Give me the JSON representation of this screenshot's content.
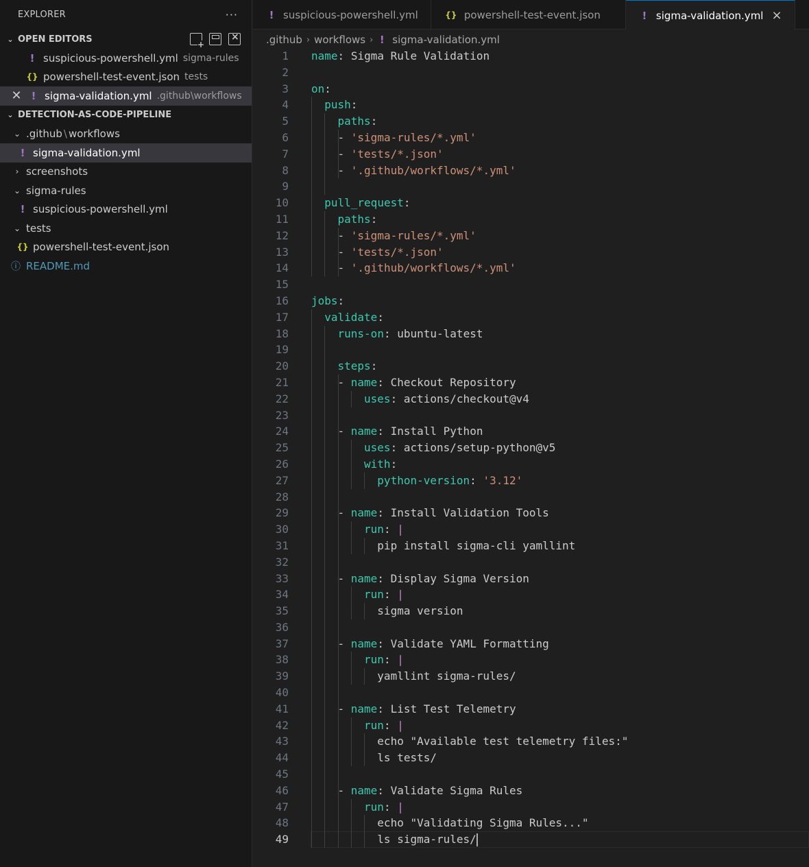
{
  "sidebar": {
    "title": "EXPLORER",
    "more": "···",
    "open_editors": {
      "label": "OPEN EDITORS",
      "items": [
        {
          "name": "suspicious-powershell.yml",
          "desc": "sigma-rules",
          "icon": "yaml-icon"
        },
        {
          "name": "powershell-test-event.json",
          "desc": "tests",
          "icon": "json-icon"
        },
        {
          "name": "sigma-validation.yml",
          "desc": ".github\\workflows",
          "icon": "yaml-icon"
        }
      ]
    },
    "project": {
      "label": "DETECTION-AS-CODE-PIPELINE",
      "tree": {
        "github_folder": ".github",
        "github_sep": "\\",
        "github_sub": "workflows",
        "workflow_file": "sigma-validation.yml",
        "screenshots": "screenshots",
        "sigma_rules": "sigma-rules",
        "sigma_file": "suspicious-powershell.yml",
        "tests": "tests",
        "tests_file": "powershell-test-event.json",
        "readme": "README.md"
      }
    }
  },
  "tabs": [
    {
      "label": "suspicious-powershell.yml"
    },
    {
      "label": "powershell-test-event.json"
    },
    {
      "label": "sigma-validation.yml",
      "close": "×"
    }
  ],
  "breadcrumb": [
    ".github",
    "workflows",
    "sigma-validation.yml"
  ],
  "editor": {
    "lines": [
      {
        "n": "1",
        "k": "name",
        "v": "Sigma Rule Validation"
      },
      {
        "n": "2"
      },
      {
        "n": "3",
        "k": "on"
      },
      {
        "n": "4",
        "k": "push"
      },
      {
        "n": "5",
        "k": "paths"
      },
      {
        "n": "6",
        "dash": "- ",
        "s": "'sigma-rules/*.yml'"
      },
      {
        "n": "7",
        "dash": "- ",
        "s": "'tests/*.json'"
      },
      {
        "n": "8",
        "dash": "- ",
        "s": "'.github/workflows/*.yml'"
      },
      {
        "n": "9"
      },
      {
        "n": "10",
        "k": "pull_request"
      },
      {
        "n": "11",
        "k": "paths"
      },
      {
        "n": "12",
        "dash": "- ",
        "s": "'sigma-rules/*.yml'"
      },
      {
        "n": "13",
        "dash": "- ",
        "s": "'tests/*.json'"
      },
      {
        "n": "14",
        "dash": "- ",
        "s": "'.github/workflows/*.yml'"
      },
      {
        "n": "15"
      },
      {
        "n": "16",
        "k": "jobs"
      },
      {
        "n": "17",
        "k": "validate"
      },
      {
        "n": "18",
        "k": "runs-on",
        "v": "ubuntu-latest"
      },
      {
        "n": "19"
      },
      {
        "n": "20",
        "k": "steps"
      },
      {
        "n": "21",
        "dash": "- ",
        "k": "name",
        "v": "Checkout Repository"
      },
      {
        "n": "22",
        "k": "uses",
        "v": "actions/checkout@v4"
      },
      {
        "n": "23"
      },
      {
        "n": "24",
        "dash": "- ",
        "k": "name",
        "v": "Install Python"
      },
      {
        "n": "25",
        "k": "uses",
        "v": "actions/setup-python@v5"
      },
      {
        "n": "26",
        "k": "with"
      },
      {
        "n": "27",
        "k": "python-version",
        "s": "'3.12'"
      },
      {
        "n": "28"
      },
      {
        "n": "29",
        "dash": "- ",
        "k": "name",
        "v": "Install Validation Tools"
      },
      {
        "n": "30",
        "k": "run",
        "pipe": "|"
      },
      {
        "n": "31",
        "v": "pip install sigma-cli yamllint"
      },
      {
        "n": "32"
      },
      {
        "n": "33",
        "dash": "- ",
        "k": "name",
        "v": "Display Sigma Version"
      },
      {
        "n": "34",
        "k": "run",
        "pipe": "|"
      },
      {
        "n": "35",
        "v": "sigma version"
      },
      {
        "n": "36"
      },
      {
        "n": "37",
        "dash": "- ",
        "k": "name",
        "v": "Validate YAML Formatting"
      },
      {
        "n": "38",
        "k": "run",
        "pipe": "|"
      },
      {
        "n": "39",
        "v": "yamllint sigma-rules/"
      },
      {
        "n": "40"
      },
      {
        "n": "41",
        "dash": "- ",
        "k": "name",
        "v": "List Test Telemetry"
      },
      {
        "n": "42",
        "k": "run",
        "pipe": "|"
      },
      {
        "n": "43",
        "v": "echo \"Available test telemetry files:\""
      },
      {
        "n": "44",
        "v": "ls tests/"
      },
      {
        "n": "45"
      },
      {
        "n": "46",
        "dash": "- ",
        "k": "name",
        "v": "Validate Sigma Rules"
      },
      {
        "n": "47",
        "k": "run",
        "pipe": "|"
      },
      {
        "n": "48",
        "v": "echo \"Validating Sigma Rules...\""
      },
      {
        "n": "49",
        "v": "ls sigma-rules/"
      }
    ]
  }
}
